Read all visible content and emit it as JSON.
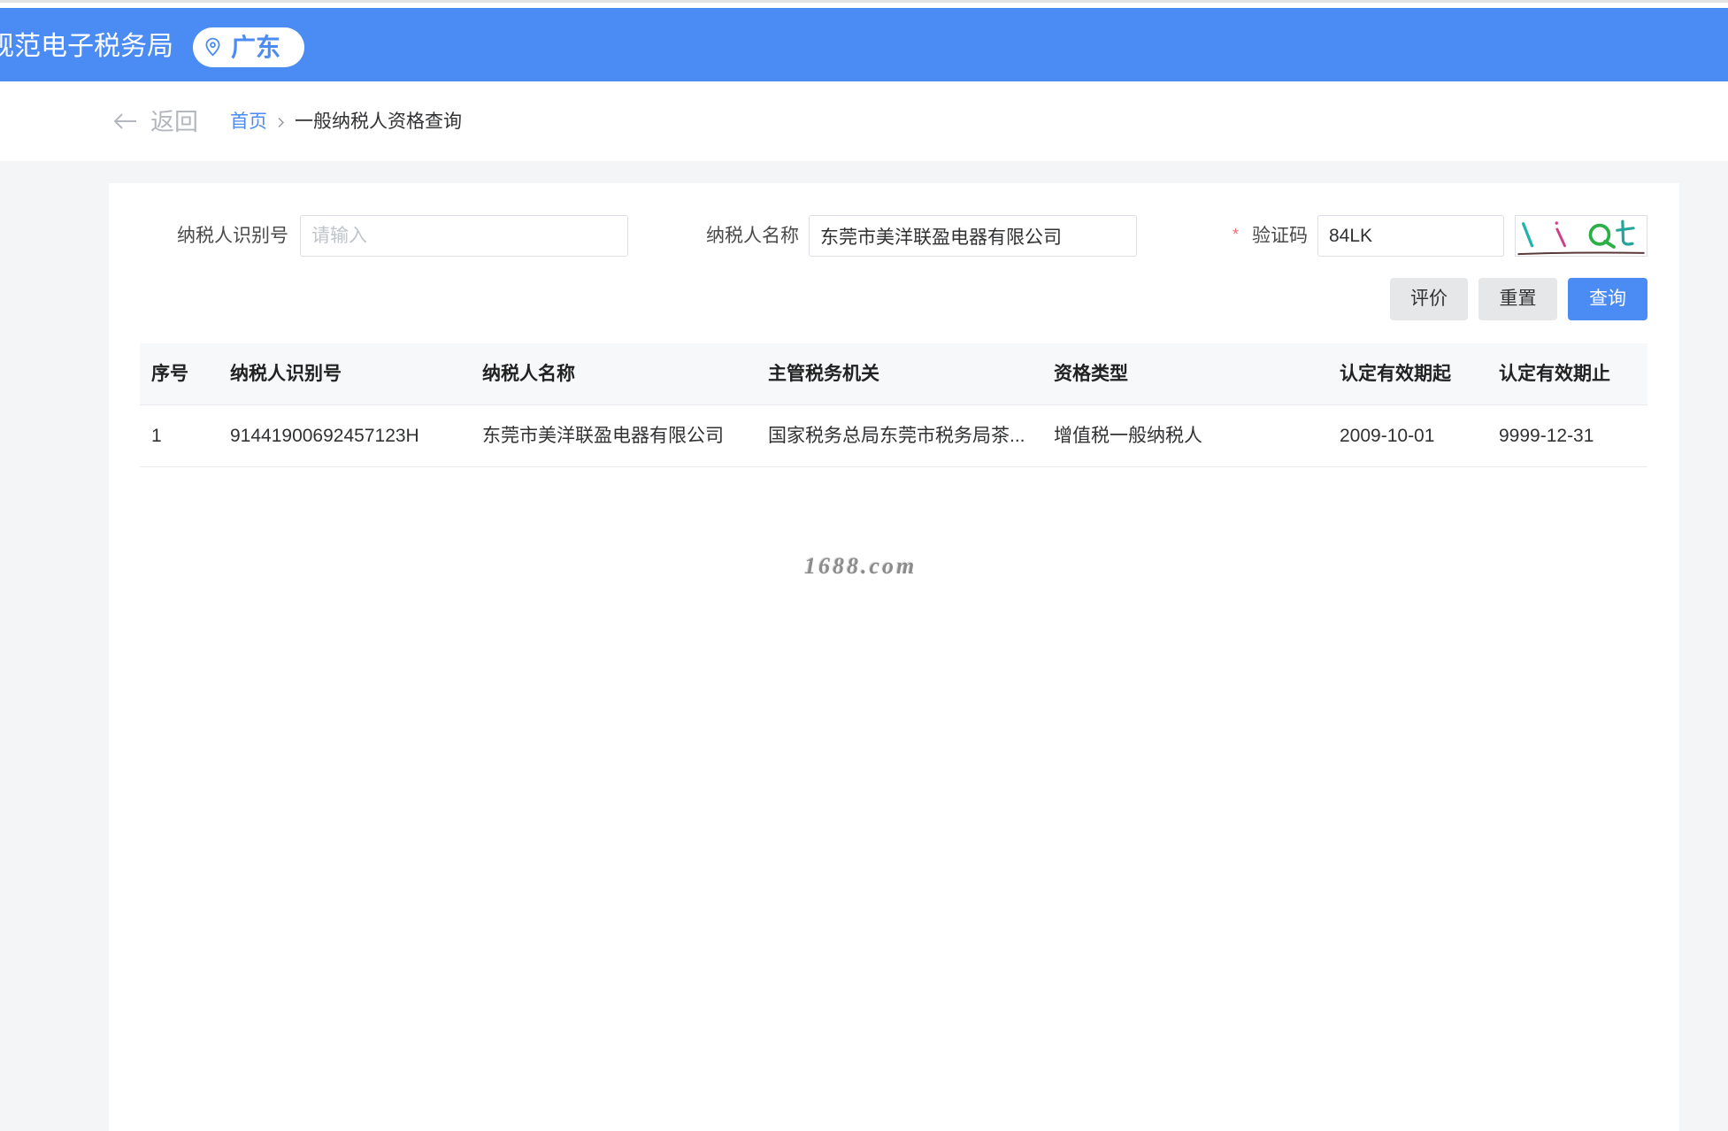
{
  "header": {
    "title": "规范电子税务局",
    "region": "广东"
  },
  "breadcrumb": {
    "back_label": "返回",
    "home": "首页",
    "current": "一般纳税人资格查询"
  },
  "form": {
    "taxpayer_id": {
      "label": "纳税人识别号",
      "placeholder": "请输入"
    },
    "taxpayer_name": {
      "label": "纳税人名称",
      "value": "东莞市美洋联盈电器有限公司"
    },
    "captcha": {
      "required_mark": "*",
      "label": "验证码",
      "value": "84LK"
    }
  },
  "actions": {
    "evaluate": "评价",
    "reset": "重置",
    "query": "查询"
  },
  "table": {
    "columns": [
      "序号",
      "纳税人识别号",
      "纳税人名称",
      "主管税务机关",
      "资格类型",
      "认定有效期起",
      "认定有效期止"
    ],
    "rows": [
      [
        "1",
        "91441900692457123H",
        "东莞市美洋联盈电器有限公司",
        "国家税务总局东莞市税务局茶...",
        "增值税一般纳税人",
        "2009-10-01",
        "9999-12-31"
      ]
    ]
  },
  "watermark": "1688.com",
  "icons": {
    "region": "location-pin-icon",
    "back": "arrow-left-icon",
    "breadcrumb_separator": "chevron-right-icon",
    "captcha": "captcha-image"
  },
  "colors": {
    "primary": "#4b8bf4",
    "page_background": "#f4f5f7",
    "required": "#f56c6c",
    "secondary_button": "#e6e7e9"
  }
}
